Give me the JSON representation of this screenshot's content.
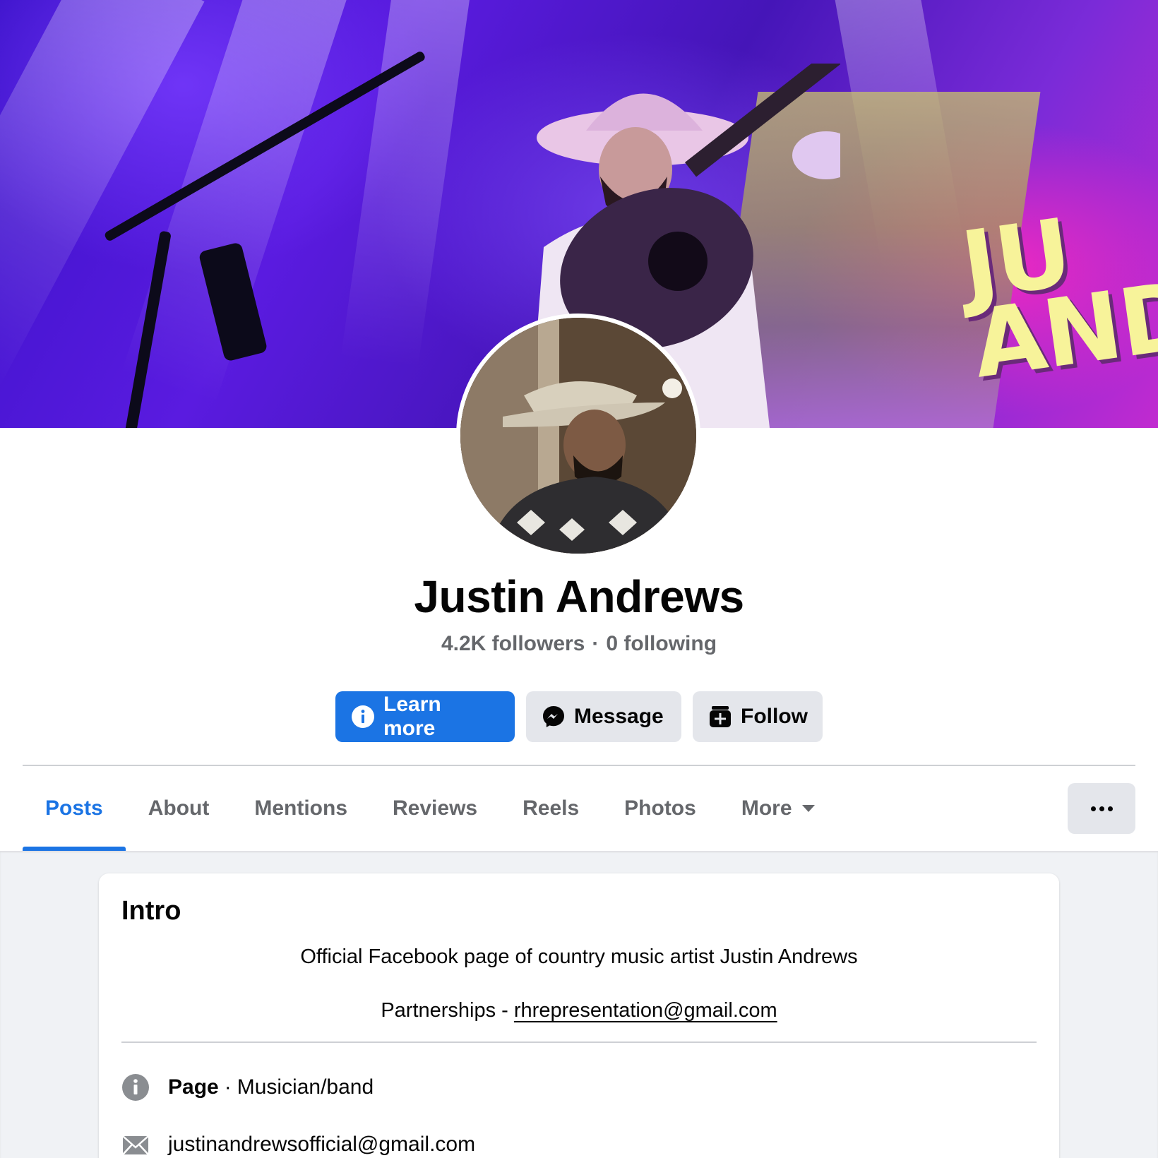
{
  "profile": {
    "name": "Justin Andrews",
    "followers": "4.2K followers",
    "separator": "·",
    "following": "0 following"
  },
  "cover": {
    "screen_text_line1": "JU",
    "screen_text_line2": "AND"
  },
  "actions": {
    "learn_more": "Learn more",
    "message": "Message",
    "follow": "Follow"
  },
  "tabs": [
    {
      "label": "Posts",
      "active": true
    },
    {
      "label": "About"
    },
    {
      "label": "Mentions"
    },
    {
      "label": "Reviews"
    },
    {
      "label": "Reels"
    },
    {
      "label": "Photos"
    },
    {
      "label": "More"
    }
  ],
  "intro": {
    "title": "Intro",
    "bio": "Official Facebook page of country music artist Justin Andrews",
    "partnerships_label": "Partnerships - ",
    "partnerships_email": "rhrepresentation@gmail.com",
    "page_label": "Page",
    "page_separator": "·",
    "category": "Musician/band",
    "contact_email": "justinandrewsofficial@gmail.com"
  },
  "colors": {
    "accent": "#1b74e4",
    "secondary_button": "#e4e6eb",
    "muted_text": "#65676b",
    "feed_background": "#f0f2f5"
  },
  "icons": {
    "learn_more": "info-icon",
    "message": "messenger-icon",
    "follow": "follow-icon",
    "more_tab": "caret-down-icon",
    "overflow": "ellipsis-icon",
    "page_info": "info-circle-icon",
    "email": "envelope-icon"
  }
}
